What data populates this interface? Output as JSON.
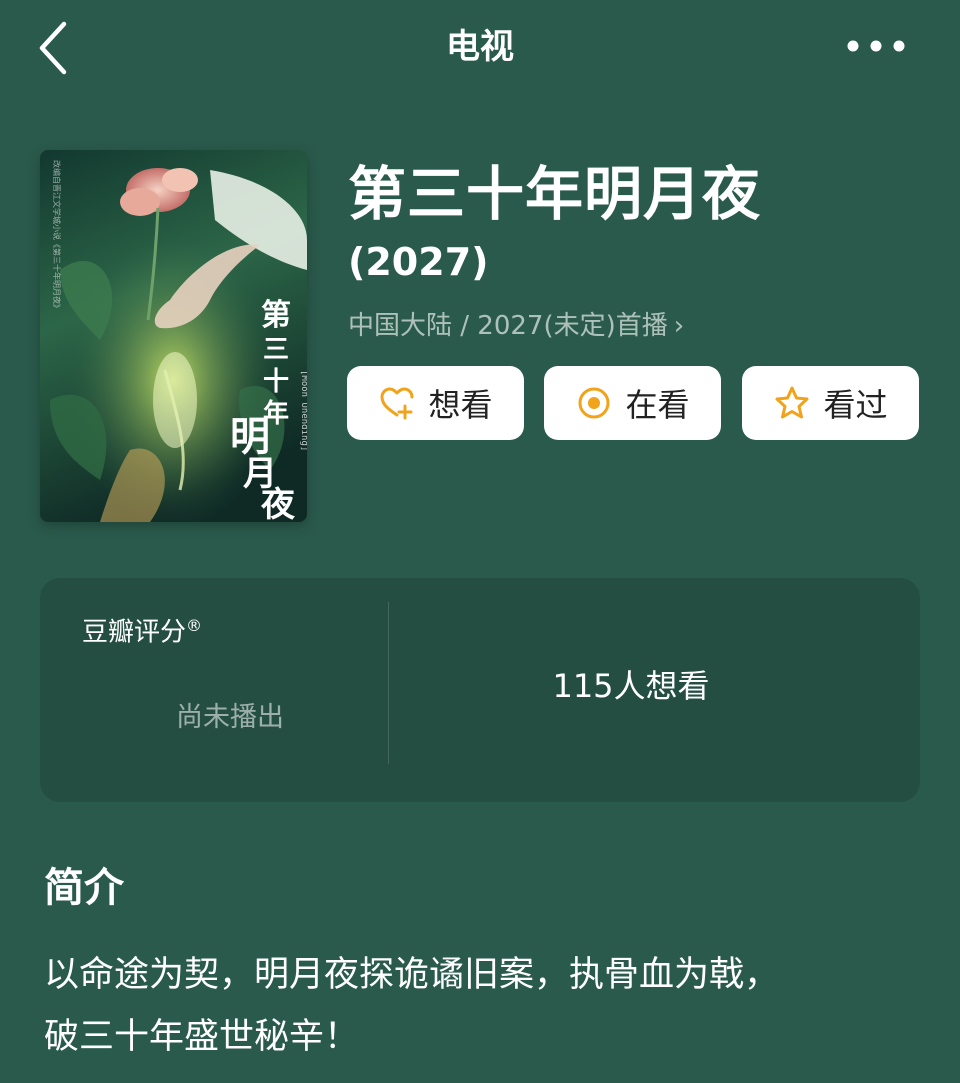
{
  "header": {
    "title": "电视",
    "back_icon": "chevron-left-icon",
    "more_icon": "more-dots-icon"
  },
  "work": {
    "title": "第三十年明月夜",
    "year": "(2027)",
    "meta": "中国大陆 / 2027(未定)首播",
    "meta_chevron": "›"
  },
  "poster": {
    "title_vertical": "第三十年明月夜",
    "subtitle": "[Moon Unending]",
    "note": "改编自晋江文学城小说《第三十年明月夜》"
  },
  "actions": [
    {
      "label": "想看",
      "icon": "heart-plus-icon"
    },
    {
      "label": "在看",
      "icon": "target-icon"
    },
    {
      "label": "看过",
      "icon": "star-icon"
    }
  ],
  "rating": {
    "label": "豆瓣评分",
    "trademark": "®",
    "status": "尚未播出",
    "want_count": "115人想看"
  },
  "intro": {
    "heading": "简介",
    "lines": [
      "以命途为契，明月夜探诡谲旧案，执骨血为戟，",
      "破三十年盛世秘辛！"
    ]
  },
  "colors": {
    "background": "#2a5a4b",
    "card": "#244e42",
    "accent": "#f0a31b"
  }
}
